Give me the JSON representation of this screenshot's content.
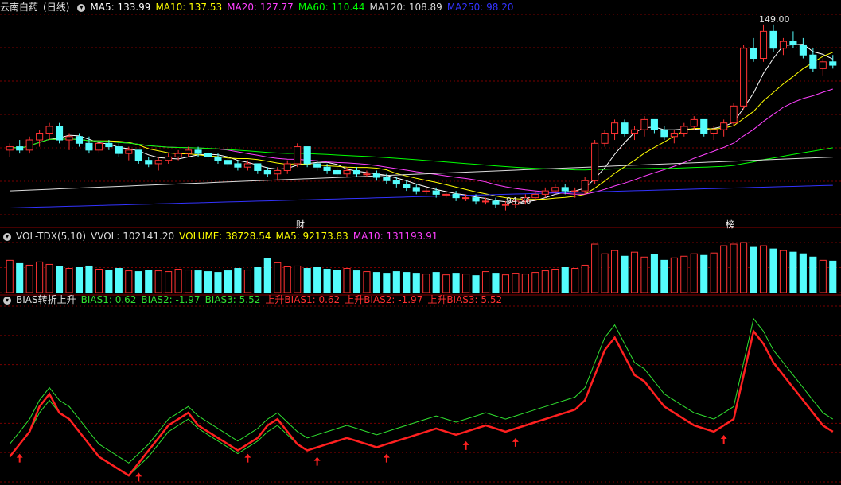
{
  "stock": {
    "name": "云南白药",
    "period": "(日线)"
  },
  "colors": {
    "up": "#ff3333",
    "down": "#54fcfc",
    "ma5": "#ffffff",
    "ma10": "#ffff00",
    "ma20": "#ff40ff",
    "ma60": "#00ff00",
    "ma120": "#dcdcdc",
    "ma250": "#3333ff",
    "grid": "#7a0000",
    "bias1": "#30e030",
    "bias2": "#30e030",
    "bias_up": "#ff2020"
  },
  "price_panel": {
    "indicators": [
      {
        "label": "MA5: 133.99",
        "color": "#ffffff"
      },
      {
        "label": "MA10: 137.53",
        "color": "#ffff00"
      },
      {
        "label": "MA20: 127.77",
        "color": "#ff40ff"
      },
      {
        "label": "MA60: 110.44",
        "color": "#00ff00"
      },
      {
        "label": "MA120: 108.89",
        "color": "#dcdcdc"
      },
      {
        "label": "MA250: 98.20",
        "color": "#3333ff"
      }
    ],
    "high_label": "149.00",
    "low_label": "94.26",
    "markers": [
      "财",
      "榜"
    ]
  },
  "volume_panel": {
    "indicators": [
      {
        "label": "VOL-TDX(5,10)",
        "color": "#dcdcdc"
      },
      {
        "label": "VVOL: 102141.20",
        "color": "#dcdcdc"
      },
      {
        "label": "VOLUME: 38728.54",
        "color": "#ffff00"
      },
      {
        "label": "MA5: 92173.83",
        "color": "#ffff00"
      },
      {
        "label": "MA10: 131193.91",
        "color": "#ff40ff"
      }
    ]
  },
  "bias_panel": {
    "indicators": [
      {
        "label": "BIAS转折上升",
        "color": "#dcdcdc"
      },
      {
        "label": "BIAS1: 0.62",
        "color": "#30e030"
      },
      {
        "label": "BIAS2: -1.97",
        "color": "#30e030"
      },
      {
        "label": "BIAS3: 5.52",
        "color": "#30e030"
      },
      {
        "label": "上升BIAS1: 0.62",
        "color": "#ff3030"
      },
      {
        "label": "上升BIAS2: -1.97",
        "color": "#ff3030"
      },
      {
        "label": "上升BIAS3: 5.52",
        "color": "#ff3030"
      }
    ]
  },
  "chart_data": {
    "type": "line",
    "ylim": [
      93,
      152
    ],
    "candles": [
      [
        112,
        114,
        110,
        113
      ],
      [
        113,
        115,
        111,
        112
      ],
      [
        112,
        116,
        111,
        115
      ],
      [
        115,
        118,
        113,
        117
      ],
      [
        117,
        120,
        115,
        119
      ],
      [
        119,
        120,
        114,
        115
      ],
      [
        115,
        117,
        112,
        116
      ],
      [
        116,
        117,
        113,
        114
      ],
      [
        114,
        116,
        111,
        112
      ],
      [
        112,
        115,
        111,
        114
      ],
      [
        114,
        115,
        112,
        113
      ],
      [
        113,
        114,
        110,
        111
      ],
      [
        111,
        113,
        109,
        112
      ],
      [
        112,
        112,
        108,
        109
      ],
      [
        109,
        110,
        107,
        108
      ],
      [
        108,
        110,
        106,
        109
      ],
      [
        109,
        111,
        108,
        110
      ],
      [
        110,
        112,
        109,
        111
      ],
      [
        111,
        113,
        110,
        112
      ],
      [
        112,
        113,
        110,
        111
      ],
      [
        111,
        112,
        109,
        110
      ],
      [
        110,
        111,
        108,
        109
      ],
      [
        109,
        110,
        107,
        108
      ],
      [
        108,
        109,
        106,
        107
      ],
      [
        107,
        109,
        106,
        108
      ],
      [
        108,
        108,
        105,
        106
      ],
      [
        106,
        107,
        104,
        105
      ],
      [
        105,
        107,
        103,
        106
      ],
      [
        106,
        109,
        105,
        108
      ],
      [
        108,
        114,
        107,
        113
      ],
      [
        113,
        113,
        107,
        108
      ],
      [
        108,
        109,
        106,
        107
      ],
      [
        107,
        108,
        105,
        106
      ],
      [
        106,
        107,
        104,
        105
      ],
      [
        105,
        107,
        104,
        106
      ],
      [
        106,
        107,
        104,
        105
      ],
      [
        105,
        106,
        104,
        105
      ],
      [
        105,
        106,
        103,
        104
      ],
      [
        104,
        105,
        102,
        103
      ],
      [
        103,
        104,
        101,
        102
      ],
      [
        102,
        103,
        100,
        101
      ],
      [
        101,
        102,
        99,
        100
      ],
      [
        100,
        101,
        99,
        100
      ],
      [
        100,
        101,
        98,
        99
      ],
      [
        99,
        100,
        98,
        99
      ],
      [
        99,
        100,
        97,
        98
      ],
      [
        98,
        99,
        97,
        98
      ],
      [
        98,
        99,
        96,
        97
      ],
      [
        97,
        98,
        96,
        97
      ],
      [
        97,
        98,
        95,
        96
      ],
      [
        96,
        97,
        94.26,
        96
      ],
      [
        96,
        98,
        95,
        97
      ],
      [
        97,
        99,
        96,
        98
      ],
      [
        98,
        100,
        97,
        99
      ],
      [
        99,
        101,
        98,
        100
      ],
      [
        100,
        102,
        99,
        101
      ],
      [
        101,
        102,
        99,
        100
      ],
      [
        100,
        101,
        98,
        100
      ],
      [
        100,
        104,
        99,
        103
      ],
      [
        103,
        115,
        102,
        114
      ],
      [
        114,
        118,
        113,
        117
      ],
      [
        117,
        121,
        115,
        120
      ],
      [
        120,
        121,
        116,
        117
      ],
      [
        117,
        119,
        115,
        118
      ],
      [
        118,
        122,
        116,
        121
      ],
      [
        121,
        121,
        117,
        118
      ],
      [
        118,
        119,
        115,
        116
      ],
      [
        116,
        118,
        114,
        117
      ],
      [
        117,
        120,
        116,
        119
      ],
      [
        119,
        122,
        118,
        121
      ],
      [
        121,
        121,
        116,
        117
      ],
      [
        117,
        119,
        115,
        118
      ],
      [
        118,
        121,
        116,
        120
      ],
      [
        120,
        126,
        119,
        125
      ],
      [
        125,
        143,
        124,
        142
      ],
      [
        142,
        145,
        138,
        139
      ],
      [
        139,
        149,
        138,
        147
      ],
      [
        147,
        149,
        141,
        142
      ],
      [
        142,
        145,
        140,
        144
      ],
      [
        144,
        147,
        142,
        143
      ],
      [
        143,
        145,
        139,
        140
      ],
      [
        140,
        142,
        135,
        136
      ],
      [
        136,
        139,
        134,
        138
      ],
      [
        138,
        140,
        136,
        137
      ]
    ],
    "volume": [
      40,
      36,
      34,
      38,
      35,
      32,
      30,
      31,
      33,
      29,
      28,
      30,
      27,
      26,
      28,
      27,
      26,
      29,
      28,
      27,
      26,
      25,
      27,
      30,
      28,
      31,
      42,
      37,
      32,
      33,
      30,
      31,
      29,
      28,
      30,
      27,
      26,
      25,
      24,
      26,
      25,
      24,
      23,
      25,
      22,
      24,
      23,
      21,
      26,
      24,
      22,
      24,
      23,
      25,
      27,
      29,
      31,
      30,
      34,
      60,
      48,
      52,
      45,
      50,
      44,
      47,
      40,
      43,
      45,
      48,
      46,
      49,
      58,
      60,
      62,
      56,
      58,
      54,
      52,
      50,
      48,
      44,
      40,
      39
    ],
    "bias_red": [
      -6,
      -2,
      2,
      10,
      14,
      8,
      6,
      2,
      -2,
      -6,
      -8,
      -10,
      -12,
      -8,
      -4,
      0,
      4,
      6,
      8,
      4,
      2,
      0,
      -2,
      -4,
      -2,
      0,
      4,
      6,
      2,
      -2,
      -4,
      -3,
      -2,
      -1,
      0,
      -1,
      -2,
      -3,
      -2,
      -1,
      0,
      1,
      2,
      3,
      2,
      1,
      2,
      3,
      4,
      3,
      2,
      3,
      4,
      5,
      6,
      7,
      8,
      9,
      12,
      20,
      28,
      32,
      26,
      20,
      18,
      14,
      10,
      8,
      6,
      4,
      3,
      2,
      4,
      6,
      20,
      34,
      30,
      24,
      20,
      16,
      12,
      8,
      4,
      2
    ],
    "bias_green": [
      -2,
      2,
      6,
      12,
      16,
      12,
      10,
      6,
      2,
      -2,
      -4,
      -6,
      -8,
      -5,
      -2,
      2,
      6,
      8,
      10,
      7,
      5,
      3,
      1,
      -1,
      1,
      3,
      6,
      8,
      5,
      2,
      0,
      1,
      2,
      3,
      4,
      3,
      2,
      1,
      2,
      3,
      4,
      5,
      6,
      7,
      6,
      5,
      6,
      7,
      8,
      7,
      6,
      7,
      8,
      9,
      10,
      11,
      12,
      13,
      16,
      24,
      32,
      36,
      30,
      24,
      22,
      18,
      14,
      12,
      10,
      8,
      7,
      6,
      8,
      10,
      24,
      38,
      34,
      28,
      24,
      20,
      16,
      12,
      8,
      6
    ]
  }
}
